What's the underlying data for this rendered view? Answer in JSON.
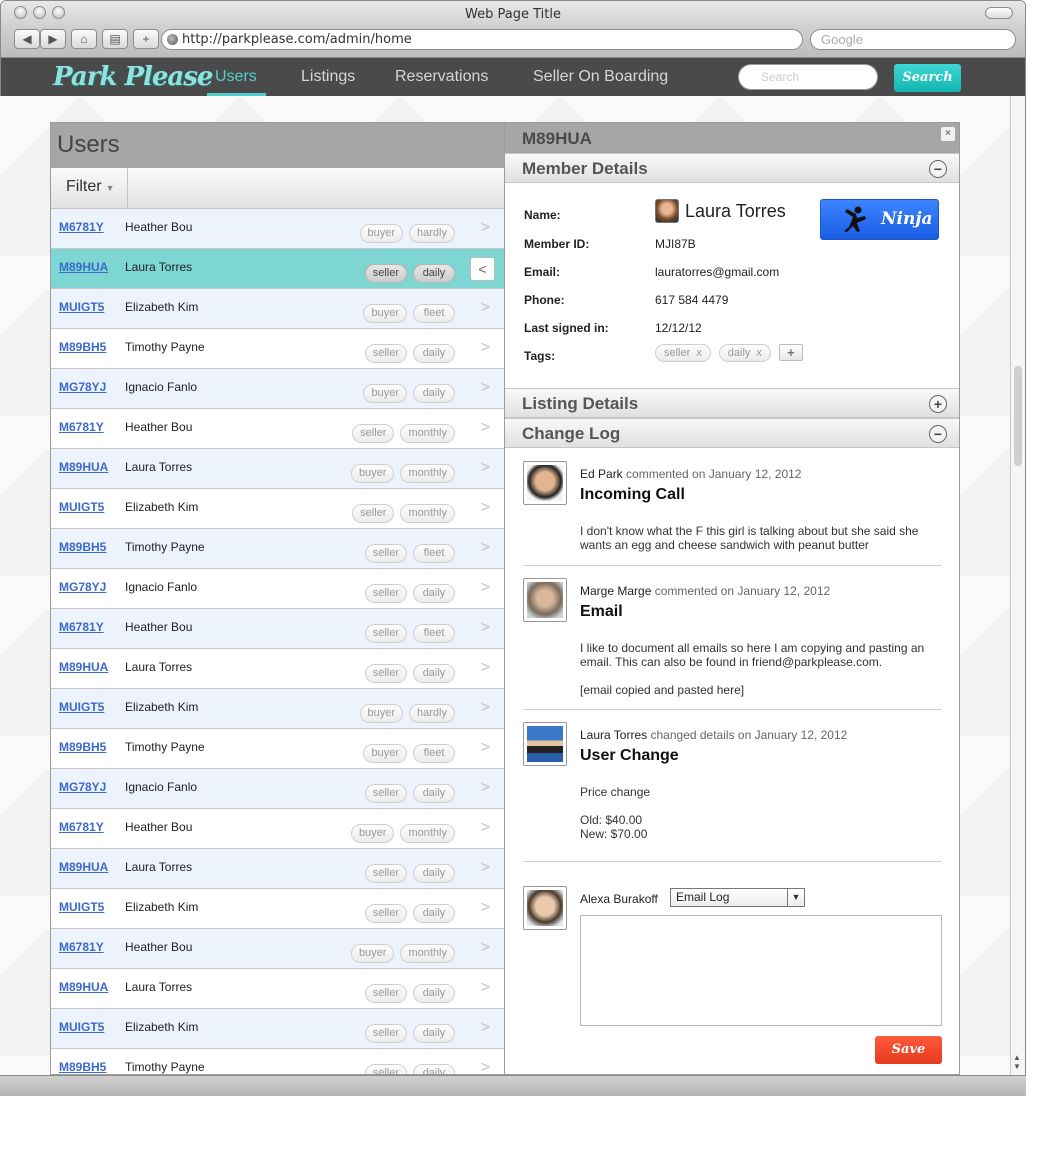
{
  "browser": {
    "window_title": "Web Page Title",
    "url": "http://parkplease.com/admin/home",
    "search_placeholder": "Google"
  },
  "nav": {
    "logo": "Park Please",
    "links": [
      "Users",
      "Listings",
      "Reservations",
      "Seller On Boarding"
    ],
    "active": "Users",
    "search_placeholder": "Search",
    "search_button": "Search",
    "accent": "#4dd0cc"
  },
  "users": {
    "title": "Users",
    "filter_label": "Filter",
    "rows": [
      {
        "id": "M6781Y",
        "name": "Heather Bou",
        "tags": [
          "buyer",
          "hardly"
        ]
      },
      {
        "id": "M89HUA",
        "name": "Laura Torres",
        "tags": [
          "seller",
          "daily"
        ]
      },
      {
        "id": "MUIGT5",
        "name": "Elizabeth Kim",
        "tags": [
          "buyer",
          "fleet"
        ]
      },
      {
        "id": "M89BH5",
        "name": "Timothy Payne",
        "tags": [
          "seller",
          "daily"
        ]
      },
      {
        "id": "MG78YJ",
        "name": "Ignacio Fanlo",
        "tags": [
          "buyer",
          "daily"
        ]
      },
      {
        "id": "M6781Y",
        "name": "Heather Bou",
        "tags": [
          "seller",
          "monthly"
        ]
      },
      {
        "id": "M89HUA",
        "name": "Laura Torres",
        "tags": [
          "buyer",
          "monthly"
        ]
      },
      {
        "id": "MUIGT5",
        "name": "Elizabeth Kim",
        "tags": [
          "seller",
          "monthly"
        ]
      },
      {
        "id": "M89BH5",
        "name": "Timothy Payne",
        "tags": [
          "seller",
          "fleet"
        ]
      },
      {
        "id": "MG78YJ",
        "name": "Ignacio Fanlo",
        "tags": [
          "seller",
          "daily"
        ]
      },
      {
        "id": "M6781Y",
        "name": "Heather Bou",
        "tags": [
          "seller",
          "fleet"
        ]
      },
      {
        "id": "M89HUA",
        "name": "Laura Torres",
        "tags": [
          "seller",
          "daily"
        ]
      },
      {
        "id": "MUIGT5",
        "name": "Elizabeth Kim",
        "tags": [
          "buyer",
          "hardly"
        ]
      },
      {
        "id": "M89BH5",
        "name": "Timothy Payne",
        "tags": [
          "buyer",
          "fleet"
        ]
      },
      {
        "id": "MG78YJ",
        "name": "Ignacio Fanlo",
        "tags": [
          "seller",
          "daily"
        ]
      },
      {
        "id": "M6781Y",
        "name": "Heather Bou",
        "tags": [
          "buyer",
          "monthly"
        ]
      },
      {
        "id": "M89HUA",
        "name": "Laura Torres",
        "tags": [
          "seller",
          "daily"
        ]
      },
      {
        "id": "MUIGT5",
        "name": "Elizabeth Kim",
        "tags": [
          "seller",
          "daily"
        ]
      },
      {
        "id": "M6781Y",
        "name": "Heather Bou",
        "tags": [
          "buyer",
          "monthly"
        ]
      },
      {
        "id": "M89HUA",
        "name": "Laura Torres",
        "tags": [
          "seller",
          "daily"
        ]
      },
      {
        "id": "MUIGT5",
        "name": "Elizabeth Kim",
        "tags": [
          "seller",
          "daily"
        ]
      },
      {
        "id": "M89BH5",
        "name": "Timothy Payne",
        "tags": [
          "seller",
          "daily"
        ]
      }
    ],
    "selected_index": 1
  },
  "detail": {
    "id": "M89HUA",
    "close_icon": "×",
    "member_section": "Member Details",
    "listing_section": "Listing Details",
    "changelog_section": "Change Log",
    "labels": {
      "name": "Name:",
      "member_id": "Member ID:",
      "email": "Email:",
      "phone": "Phone:",
      "last_signed_in": "Last signed in:",
      "tags": "Tags:"
    },
    "member": {
      "name": "Laura Torres",
      "member_id": "MJI87B",
      "email": "lauratorres@gmail.com",
      "phone": "617 584 4479",
      "last_signed_in": "12/12/12",
      "tags": [
        "seller",
        "daily"
      ]
    },
    "ninja_button": "Ninja",
    "log": [
      {
        "author": "Ed Park",
        "action": "commented on January 12, 2012",
        "title": "Incoming Call",
        "text": [
          "I don't know what the F this girl is talking about but she said she wants an egg and cheese sandwich with peanut butter"
        ]
      },
      {
        "author": "Marge Marge",
        "action": "commented on January 12, 2012",
        "title": "Email",
        "text": [
          "I like to document all emails so here I am copying and pasting an email. This can also be found in friend@parkplease.com.",
          "[email copied and pasted here]"
        ]
      },
      {
        "author": "Laura Torres",
        "action": "changed details on January 12, 2012",
        "title": "User Change",
        "text": [
          "Price change",
          "Old: $40.00",
          "New: $70.00"
        ]
      }
    ],
    "composer": {
      "author": "Alexa Burakoff",
      "type_selected": "Email Log",
      "save_button": "Save"
    }
  }
}
